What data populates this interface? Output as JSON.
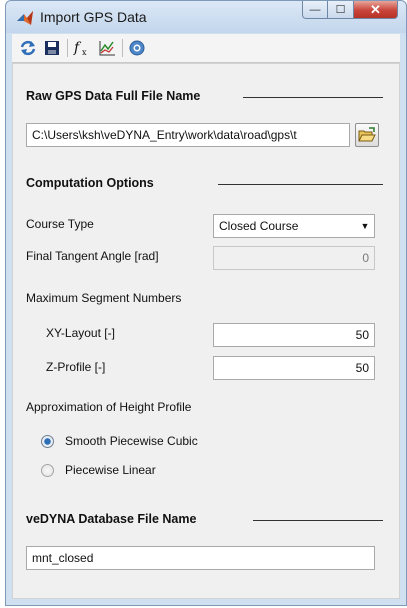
{
  "window": {
    "title": "Import GPS Data"
  },
  "titlebar_buttons": {
    "minimize": "—",
    "maximize": "☐",
    "close": "✕"
  },
  "toolbar": {
    "items": [
      {
        "icon": "refresh-icon"
      },
      {
        "icon": "save-icon"
      },
      {
        "icon": "function-icon"
      },
      {
        "icon": "plot-icon"
      },
      {
        "icon": "help-icon"
      }
    ]
  },
  "raw_file": {
    "section_title": "Raw GPS Data Full File Name",
    "path": "C:\\Users\\ksh\\veDYNA_Entry\\work\\data\\road\\gps\\t"
  },
  "computation": {
    "section_title": "Computation Options",
    "course_type_label": "Course Type",
    "course_type_value": "Closed Course",
    "final_tangent_label": "Final Tangent Angle [rad]",
    "final_tangent_value": "0",
    "max_segments_label": "Maximum Segment Numbers",
    "xy_label": "XY-Layout [-]",
    "xy_value": "50",
    "z_label": "Z-Profile [-]",
    "z_value": "50",
    "approx_label": "Approximation of Height Profile",
    "options": [
      {
        "label": "Smooth Piecewise Cubic",
        "selected": true
      },
      {
        "label": "Piecewise Linear",
        "selected": false
      }
    ]
  },
  "database": {
    "section_title": "veDYNA Database File Name",
    "file_name": "mnt_closed"
  }
}
